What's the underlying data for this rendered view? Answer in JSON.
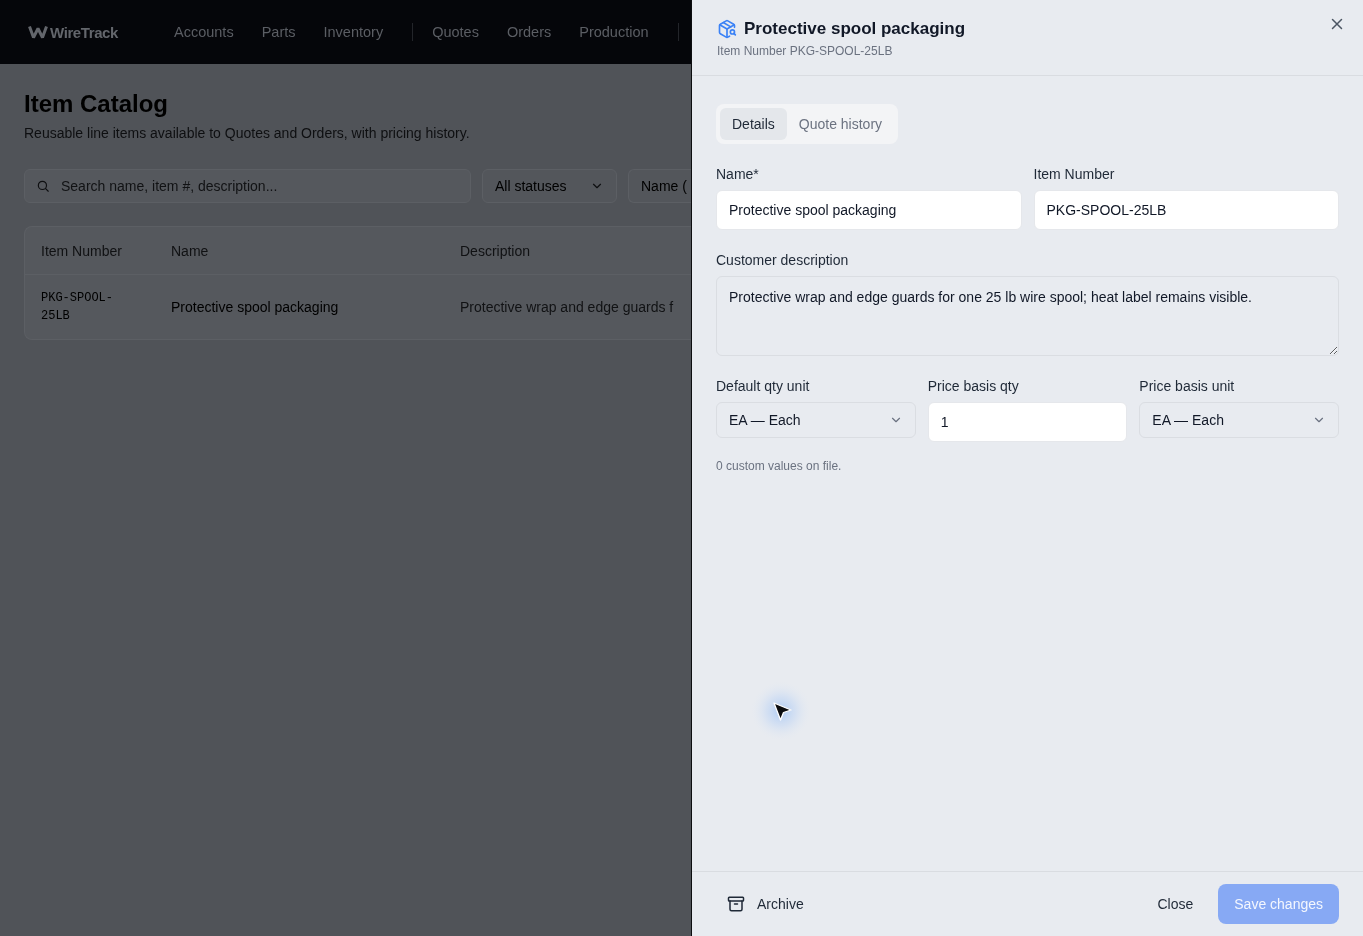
{
  "nav": {
    "brand": "WireTrack",
    "groups": [
      {
        "items": [
          {
            "label": "Accounts"
          },
          {
            "label": "Parts"
          },
          {
            "label": "Inventory"
          }
        ]
      },
      {
        "items": [
          {
            "label": "Quotes"
          },
          {
            "label": "Orders"
          },
          {
            "label": "Production"
          }
        ]
      }
    ]
  },
  "catalog": {
    "title": "Item Catalog",
    "subtitle": "Reusable line items available to Quotes and Orders, with pricing history.",
    "search": {
      "placeholder": "Search name, item #, description..."
    },
    "filters": [
      {
        "value": "All statuses"
      },
      {
        "value": "Name ("
      }
    ],
    "table": {
      "columns": [
        "Item Number",
        "Name",
        "Description"
      ],
      "rows": [
        {
          "cells": [
            "PKG-SPOOL-25LB",
            "Protective spool packaging",
            "Protective wrap and edge guards f"
          ]
        }
      ]
    }
  },
  "drawer": {
    "title": "Protective spool packaging",
    "subtitle": "Item Number PKG-SPOOL-25LB",
    "tabs": [
      {
        "label": "Details",
        "selected": true
      },
      {
        "label": "Quote history",
        "selected": false
      }
    ],
    "form_rows": [
      {
        "fields": [
          {
            "kind": "text",
            "label": "Name*",
            "value": "Protective spool packaging"
          },
          {
            "kind": "text",
            "label": "Item Number",
            "value": "PKG-SPOOL-25LB"
          }
        ]
      },
      {
        "fields": [
          {
            "kind": "textarea",
            "label": "Customer description",
            "value": "Protective wrap and edge guards for one 25 lb wire spool; heat label remains visible."
          }
        ]
      },
      {
        "fields": [
          {
            "kind": "select",
            "label": "Default qty unit",
            "value": "EA — Each"
          },
          {
            "kind": "text",
            "label": "Price basis qty",
            "value": "1"
          },
          {
            "kind": "select",
            "label": "Price basis unit",
            "value": "EA — Each"
          }
        ]
      }
    ],
    "note": "0 custom values on file.",
    "footer": {
      "archive": "Archive",
      "close": "Close",
      "save": {
        "label": "Save changes",
        "disabled": true
      }
    }
  }
}
